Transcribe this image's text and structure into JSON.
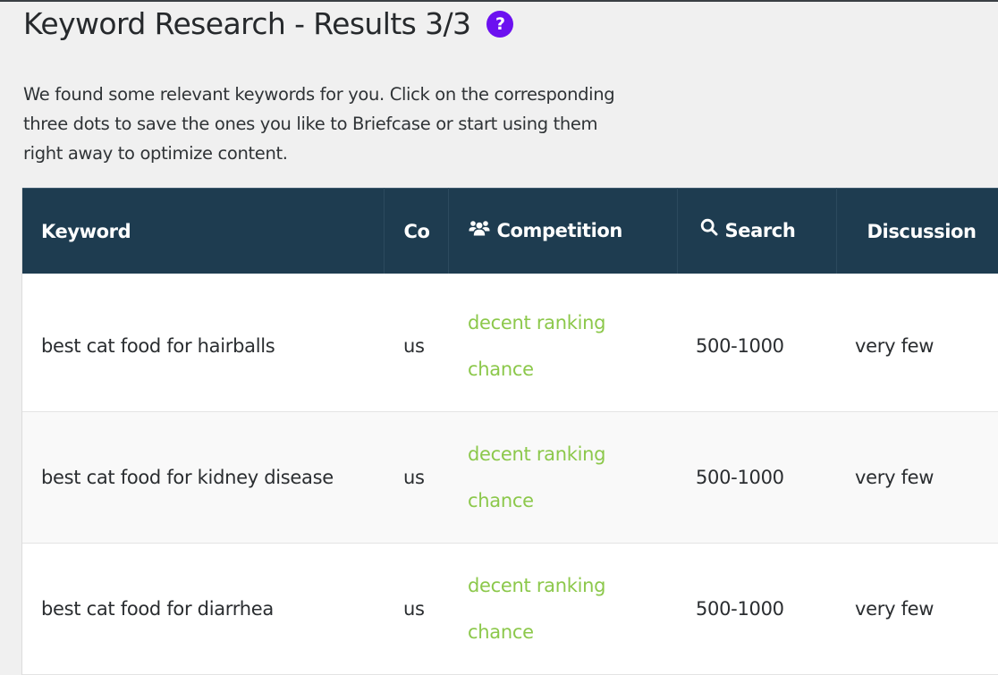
{
  "header": {
    "title": "Keyword Research - Results 3/3",
    "help_icon": "question-circle-icon",
    "help_color": "#6c10f0",
    "intro": "We found some relevant keywords for you. Click on the corresponding three dots to save the ones you like to Briefcase or start using them right away to optimize content."
  },
  "table": {
    "columns": [
      {
        "key": "keyword",
        "label": "Keyword",
        "icon": null
      },
      {
        "key": "country",
        "label": "Co",
        "icon": null
      },
      {
        "key": "competition",
        "label": "Competition",
        "icon": "users-icon"
      },
      {
        "key": "search",
        "label": "Search",
        "icon": "search-icon"
      },
      {
        "key": "discussion",
        "label": "Discussion",
        "icon": null
      }
    ],
    "header_color": "#1e3c50",
    "competition_color": "#8cc84b",
    "rows": [
      {
        "keyword": "best cat food for hairballs",
        "country": "us",
        "competition": "decent ranking chance",
        "search": "500-1000",
        "discussion": "very few"
      },
      {
        "keyword": "best cat food for kidney disease",
        "country": "us",
        "competition": "decent ranking chance",
        "search": "500-1000",
        "discussion": "very few"
      },
      {
        "keyword": "best cat food for diarrhea",
        "country": "us",
        "competition": "decent ranking chance",
        "search": "500-1000",
        "discussion": "very few"
      }
    ]
  }
}
